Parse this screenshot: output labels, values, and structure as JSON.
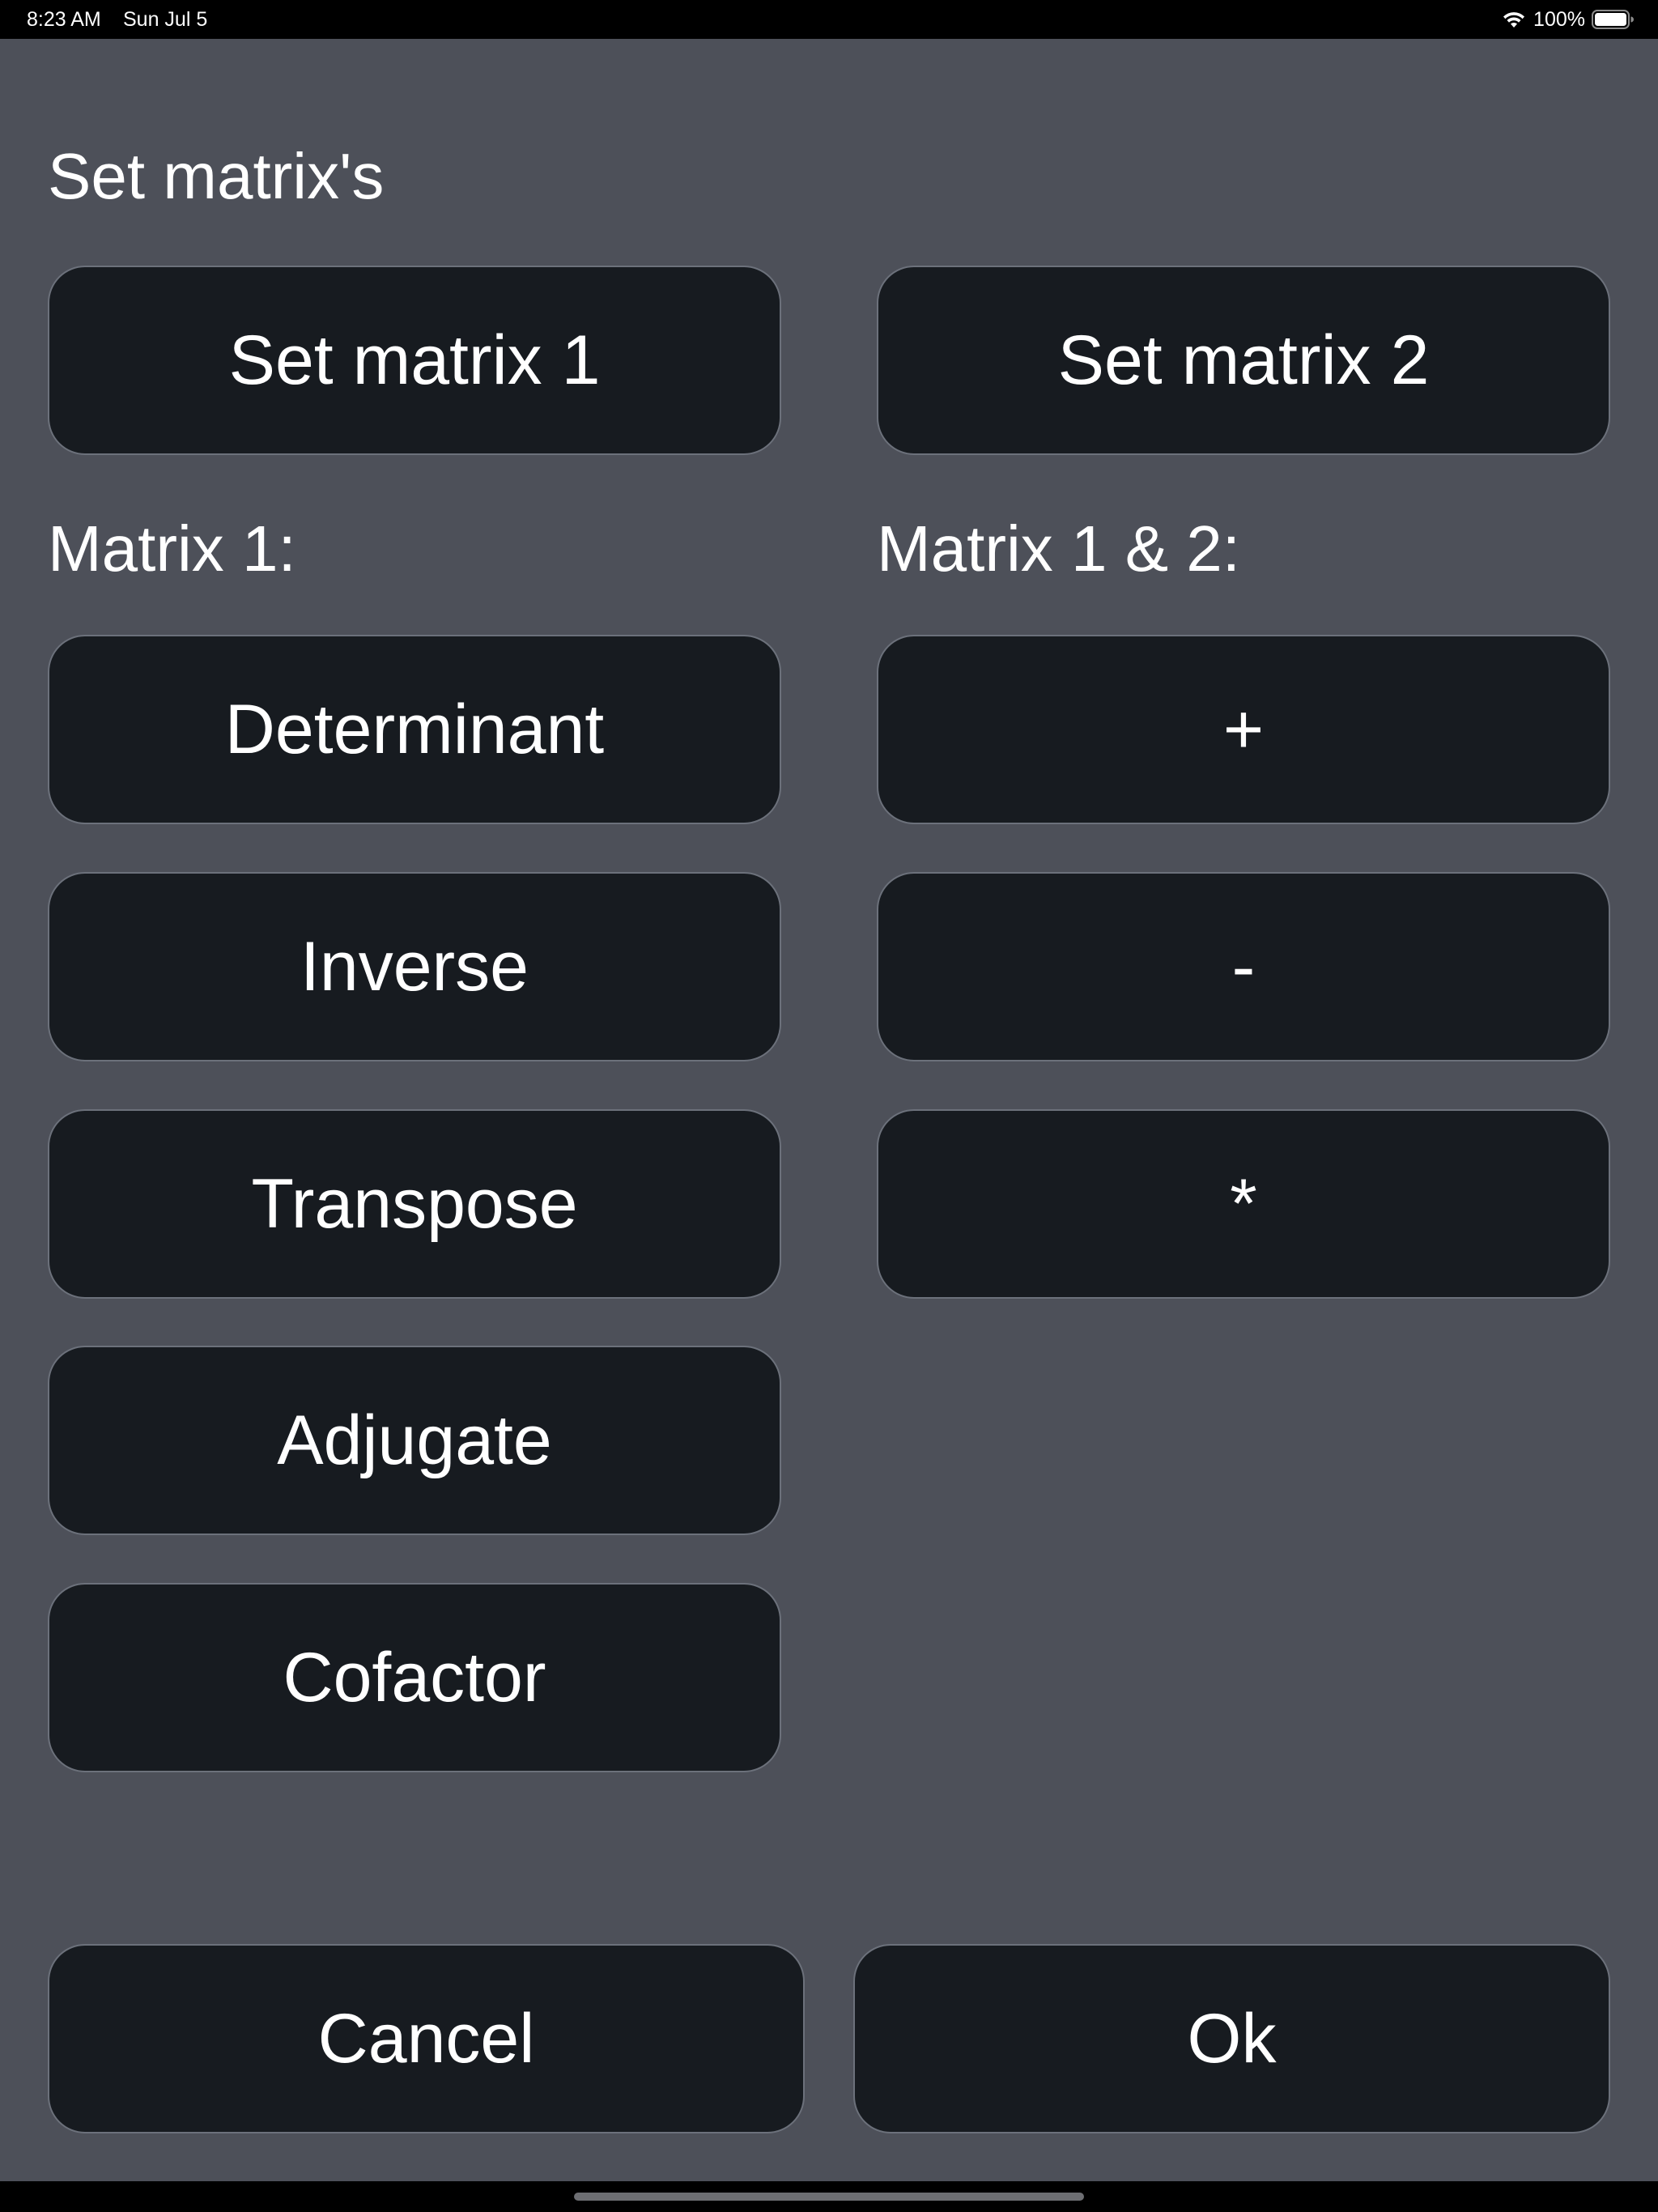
{
  "status_bar": {
    "time": "8:23 AM",
    "date": "Sun Jul 5",
    "battery": "100%",
    "icons": [
      "wifi-icon",
      "battery-icon"
    ]
  },
  "dialog": {
    "section_set_title": "Set matrix's",
    "set_matrix_1": "Set matrix 1",
    "set_matrix_2": "Set matrix 2",
    "matrix1_label": "Matrix 1:",
    "matrix12_label": "Matrix 1 & 2:",
    "matrix1_ops": [
      "Determinant",
      "Inverse",
      "Transpose",
      "Adjugate",
      "Cofactor"
    ],
    "matrix12_ops": [
      "+",
      "-",
      "*"
    ],
    "cancel": "Cancel",
    "ok": "Ok"
  },
  "colors": {
    "panel_bg": "#4d5059",
    "button_bg": "#171b20",
    "button_border": "#6c717b",
    "text": "#ffffff",
    "bar_bg": "#000000"
  }
}
